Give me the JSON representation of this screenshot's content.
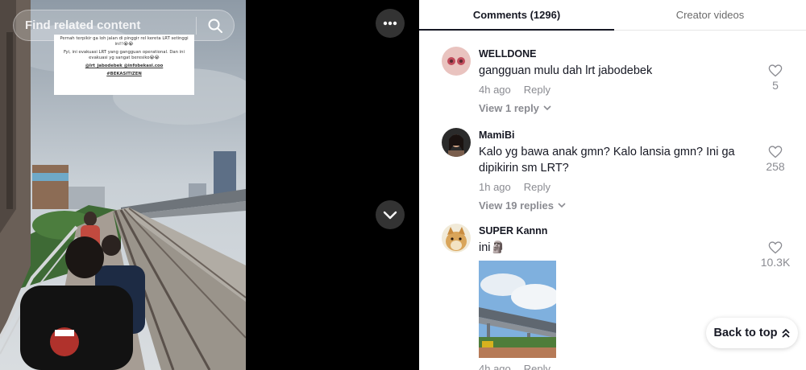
{
  "search": {
    "placeholder": "Find related content"
  },
  "video": {
    "caption": {
      "line1": "Pernah terpikir ga loh jalan di pinggir rel kereta LRT setinggi ini!!😭😭",
      "line2": "Fyi, ini evakuasi LRT yang gangguan operational. Dan ini evakuasi yg sangat beresiko😭😭",
      "mentions": "@lrt_jabodebek @infobekasi.coo",
      "hashtag": "#BEKASITIZEN"
    }
  },
  "icons": {
    "search": "search-icon",
    "more": "more-horizontal-icon",
    "down": "chevron-down-icon",
    "heart": "heart-outline-icon",
    "back_top": "double-chevron-up-icon"
  },
  "tabs": {
    "comments": "Comments (1296)",
    "creator": "Creator videos"
  },
  "comments": [
    {
      "username": "WELLDONE",
      "text": "gangguan mulu dah lrt jabodebek",
      "time": "4h ago",
      "reply_label": "Reply",
      "view_replies": "View 1 reply",
      "likes": "5"
    },
    {
      "username": "MamiBi",
      "text": "Kalo yg bawa anak gmn? Kalo lansia gmn? Ini ga dipikirin sm LRT?",
      "time": "1h ago",
      "reply_label": "Reply",
      "view_replies": "View 19 replies",
      "likes": "258"
    },
    {
      "username": "SUPER Kannn",
      "text": "ini🗿",
      "time": "4h ago",
      "reply_label": "Reply",
      "likes": "10.3K"
    }
  ],
  "back_to_top": "Back to top",
  "colors": {
    "text_primary": "#161823",
    "text_secondary": "#8a8b91",
    "video_bg": "#000000"
  }
}
